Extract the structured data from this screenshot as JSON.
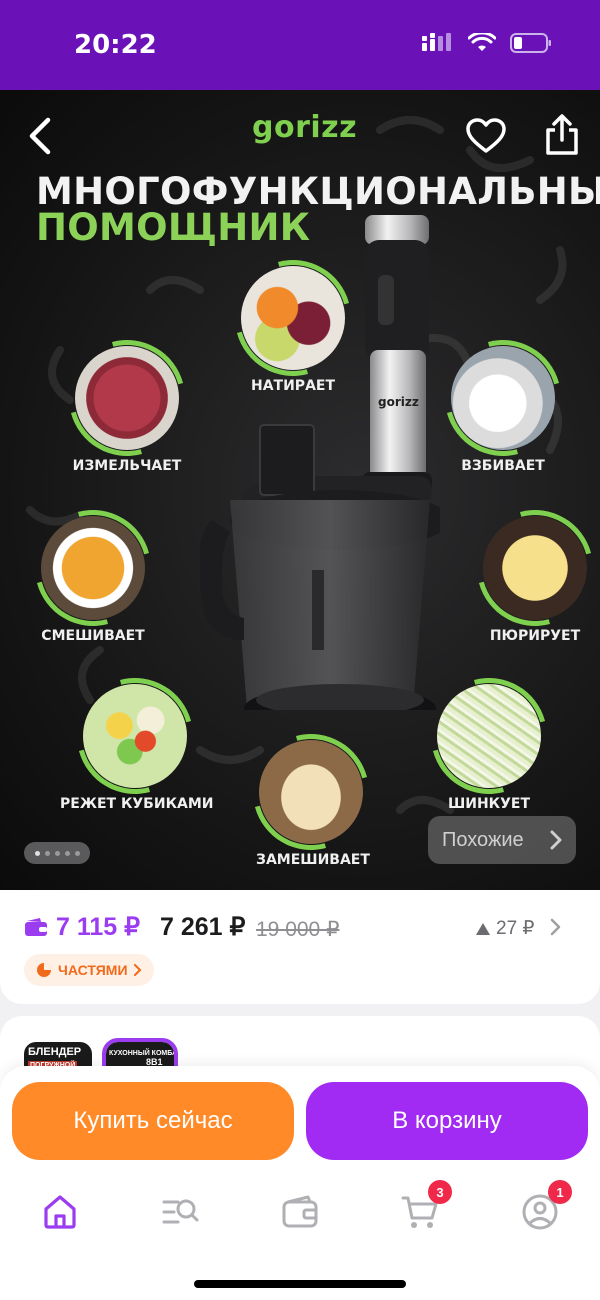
{
  "status": {
    "time": "20:22"
  },
  "header": {
    "brand": "gorizz"
  },
  "hero": {
    "headline_line1": "МНОГОФУНКЦИОНАЛЬНЫЙ",
    "headline_line2": "ПОМОЩНИК",
    "product_brand": "gorizz",
    "features": [
      {
        "label": "НАТИРАЕТ",
        "image": "grated-vegetables"
      },
      {
        "label": "ИЗМЕЛЬЧАЕТ",
        "image": "minced-meat"
      },
      {
        "label": "ВЗБИВАЕТ",
        "image": "whipped-cream"
      },
      {
        "label": "СМЕШИВАЕТ",
        "image": "soup"
      },
      {
        "label": "ПЮРИРУЕТ",
        "image": "mashed-potatoes"
      },
      {
        "label": "РЕЖЕТ КУБИКАМИ",
        "image": "diced-salad"
      },
      {
        "label": "ШИНКУЕТ",
        "image": "shredded-cabbage"
      },
      {
        "label": "ЗАМЕШИВАЕТ",
        "image": "dough"
      }
    ],
    "similar_label": "Похожие",
    "carousel": {
      "count": 5,
      "active_index": 0
    }
  },
  "price": {
    "wallet_price": "7 115 ₽",
    "main_price": "7 261 ₽",
    "old_price": "19 000 ₽",
    "delta": "27 ₽",
    "installments_label": "ЧАСТЯМИ"
  },
  "variants": [
    {
      "label": "БЛЕНДЕР",
      "sub": "ПОГРУЖНОЙ"
    },
    {
      "label": "КУХОННЫЙ КОМБАЙН",
      "sub": "8В1"
    }
  ],
  "actions": {
    "buy_now": "Купить сейчас",
    "add_to_cart": "В корзину"
  },
  "tabbar": {
    "items": [
      {
        "name": "home",
        "badge": null
      },
      {
        "name": "catalog-search",
        "badge": null
      },
      {
        "name": "wallet",
        "badge": null
      },
      {
        "name": "cart",
        "badge": "3"
      },
      {
        "name": "profile",
        "badge": "1"
      }
    ]
  },
  "colors": {
    "brand_purple": "#6a12b8",
    "accent_green": "#7fd04f",
    "buy_orange": "#ff8a27",
    "cart_purple": "#a12bf2",
    "price_purple": "#9b3cf0"
  }
}
